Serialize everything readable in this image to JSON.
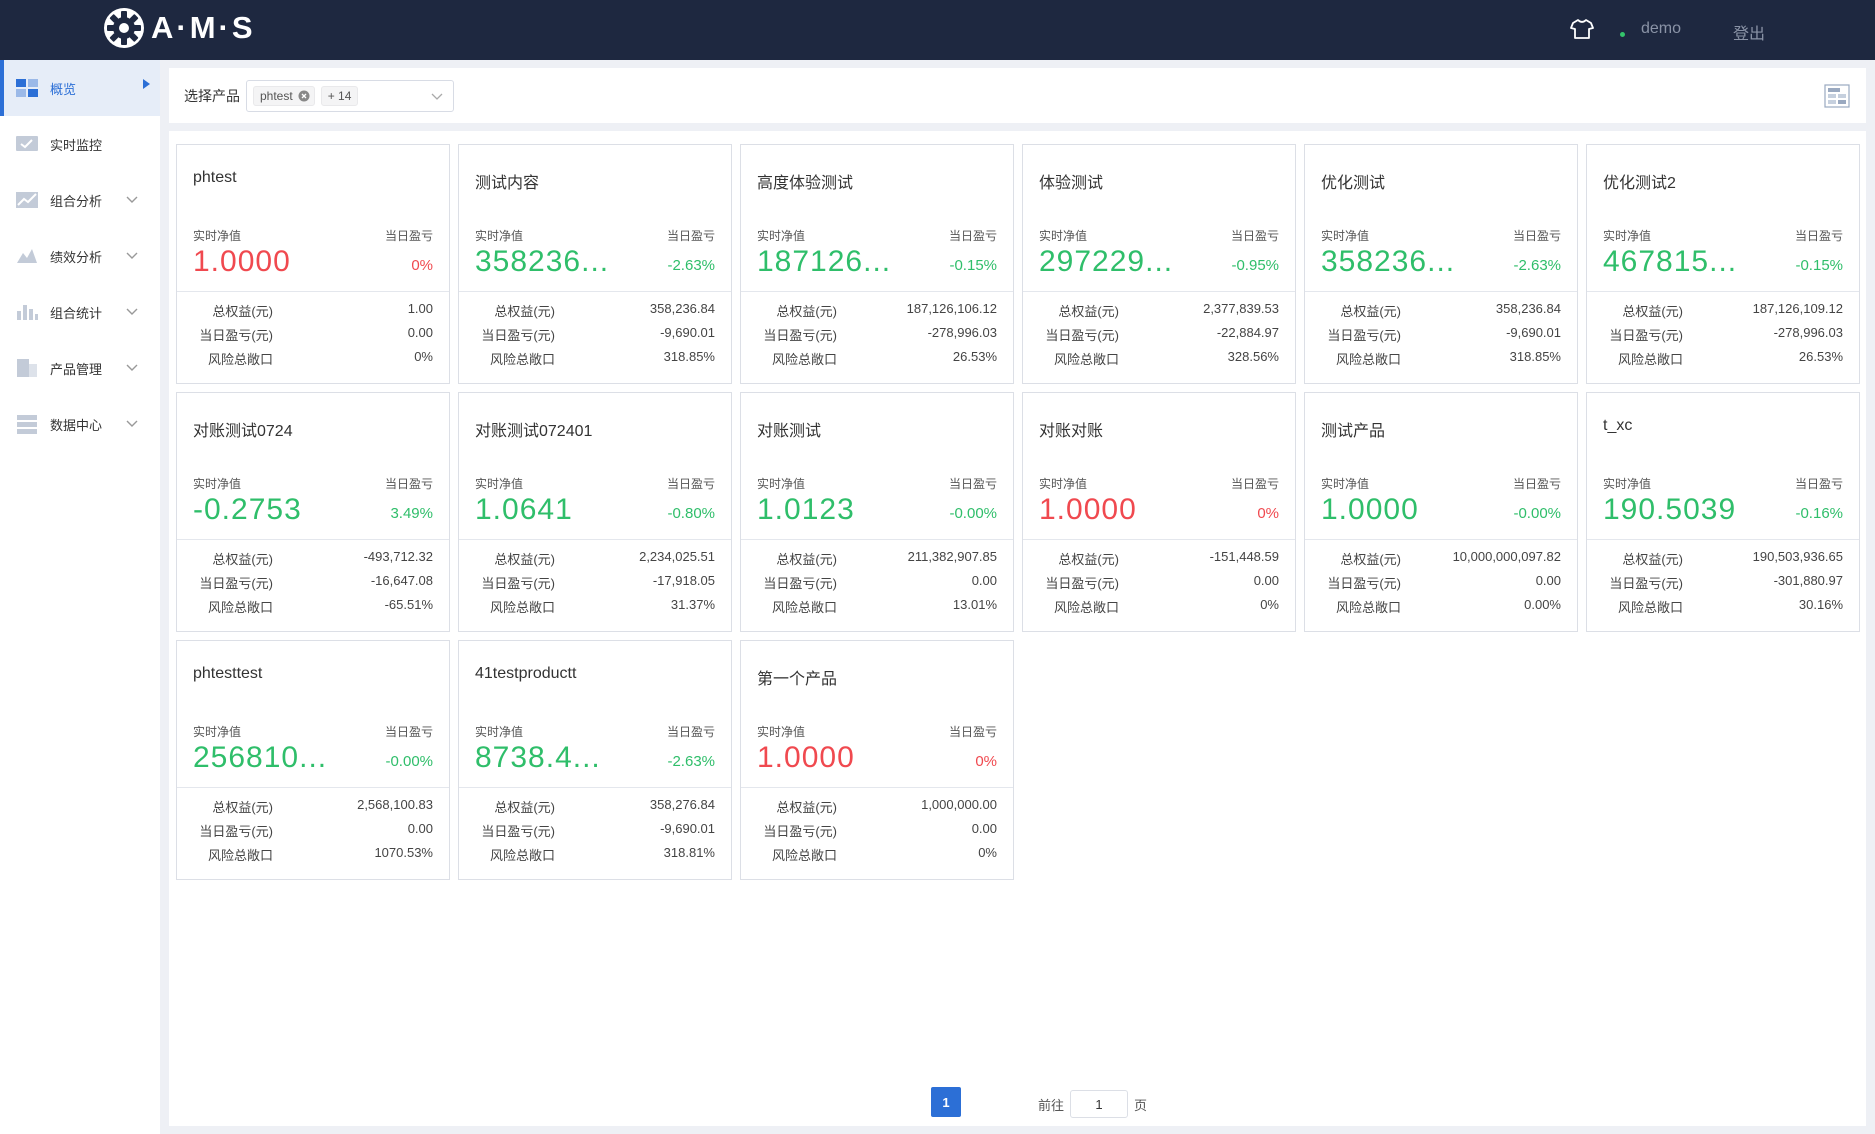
{
  "header": {
    "logo_text": "A·M·S",
    "user": "demo",
    "logout": "登出",
    "status_color": "#34c46b"
  },
  "sidebar": {
    "items": [
      {
        "label": "概览",
        "icon": "dashboard-icon",
        "active": true
      },
      {
        "label": "实时监控",
        "icon": "monitor-icon",
        "active": false
      },
      {
        "label": "组合分析",
        "icon": "line-chart-icon",
        "active": false
      },
      {
        "label": "绩效分析",
        "icon": "performance-icon",
        "active": false
      },
      {
        "label": "组合统计",
        "icon": "bar-chart-icon",
        "active": false
      },
      {
        "label": "产品管理",
        "icon": "product-icon",
        "active": false
      },
      {
        "label": "数据中心",
        "icon": "database-icon",
        "active": false
      }
    ]
  },
  "filter": {
    "label": "选择产品",
    "tag": "phtest",
    "more": "+ 14"
  },
  "card_labels": {
    "nav": "实时净值",
    "pnl": "当日盈亏",
    "equity": "总权益(元)",
    "daily_pnl": "当日盈亏(元)",
    "exposure": "风险总敞口"
  },
  "products": [
    {
      "name": "phtest",
      "nav": "1.0000",
      "pnl": "0%",
      "trend": "up",
      "equity": "1.00",
      "daily_pnl": "0.00",
      "exposure": "0%"
    },
    {
      "name": "测试内容",
      "nav": "358236...",
      "pnl": "-2.63%",
      "trend": "down",
      "equity": "358,236.84",
      "daily_pnl": "-9,690.01",
      "exposure": "318.85%"
    },
    {
      "name": "高度体验测试",
      "nav": "187126...",
      "pnl": "-0.15%",
      "trend": "down",
      "equity": "187,126,106.12",
      "daily_pnl": "-278,996.03",
      "exposure": "26.53%"
    },
    {
      "name": "体验测试",
      "nav": "297229...",
      "pnl": "-0.95%",
      "trend": "down",
      "equity": "2,377,839.53",
      "daily_pnl": "-22,884.97",
      "exposure": "328.56%"
    },
    {
      "name": "优化测试",
      "nav": "358236...",
      "pnl": "-2.63%",
      "trend": "down",
      "equity": "358,236.84",
      "daily_pnl": "-9,690.01",
      "exposure": "318.85%"
    },
    {
      "name": "优化测试2",
      "nav": "467815...",
      "pnl": "-0.15%",
      "trend": "down",
      "equity": "187,126,109.12",
      "daily_pnl": "-278,996.03",
      "exposure": "26.53%"
    },
    {
      "name": "对账测试0724",
      "nav": "-0.2753",
      "pnl": "3.49%",
      "trend": "down",
      "equity": "-493,712.32",
      "daily_pnl": "-16,647.08",
      "exposure": "-65.51%"
    },
    {
      "name": "对账测试072401",
      "nav": "1.0641",
      "pnl": "-0.80%",
      "trend": "down",
      "equity": "2,234,025.51",
      "daily_pnl": "-17,918.05",
      "exposure": "31.37%"
    },
    {
      "name": "对账测试",
      "nav": "1.0123",
      "pnl": "-0.00%",
      "trend": "down",
      "equity": "211,382,907.85",
      "daily_pnl": "0.00",
      "exposure": "13.01%"
    },
    {
      "name": "对账对账",
      "nav": "1.0000",
      "pnl": "0%",
      "trend": "up",
      "equity": "-151,448.59",
      "daily_pnl": "0.00",
      "exposure": "0%"
    },
    {
      "name": "测试产品",
      "nav": "1.0000",
      "pnl": "-0.00%",
      "trend": "down",
      "equity": "10,000,000,097.82",
      "daily_pnl": "0.00",
      "exposure": "0.00%"
    },
    {
      "name": "t_xc",
      "nav": "190.5039",
      "pnl": "-0.16%",
      "trend": "down",
      "equity": "190,503,936.65",
      "daily_pnl": "-301,880.97",
      "exposure": "30.16%"
    },
    {
      "name": "phtesttest",
      "nav": "256810...",
      "pnl": "-0.00%",
      "trend": "down",
      "equity": "2,568,100.83",
      "daily_pnl": "0.00",
      "exposure": "1070.53%"
    },
    {
      "name": "41testproductt",
      "nav": "8738.4...",
      "pnl": "-2.63%",
      "trend": "down",
      "equity": "358,276.84",
      "daily_pnl": "-9,690.01",
      "exposure": "318.81%"
    },
    {
      "name": "第一个产品",
      "nav": "1.0000",
      "pnl": "0%",
      "trend": "up",
      "equity": "1,000,000.00",
      "daily_pnl": "0.00",
      "exposure": "0%"
    }
  ],
  "pagination": {
    "current": "1",
    "goto_prefix": "前往",
    "goto_value": "1",
    "goto_suffix": "页"
  },
  "colors": {
    "accent": "#2c6fd6",
    "up": "#f0494f",
    "down": "#2fbe6a",
    "header_bg": "#1e2840"
  }
}
